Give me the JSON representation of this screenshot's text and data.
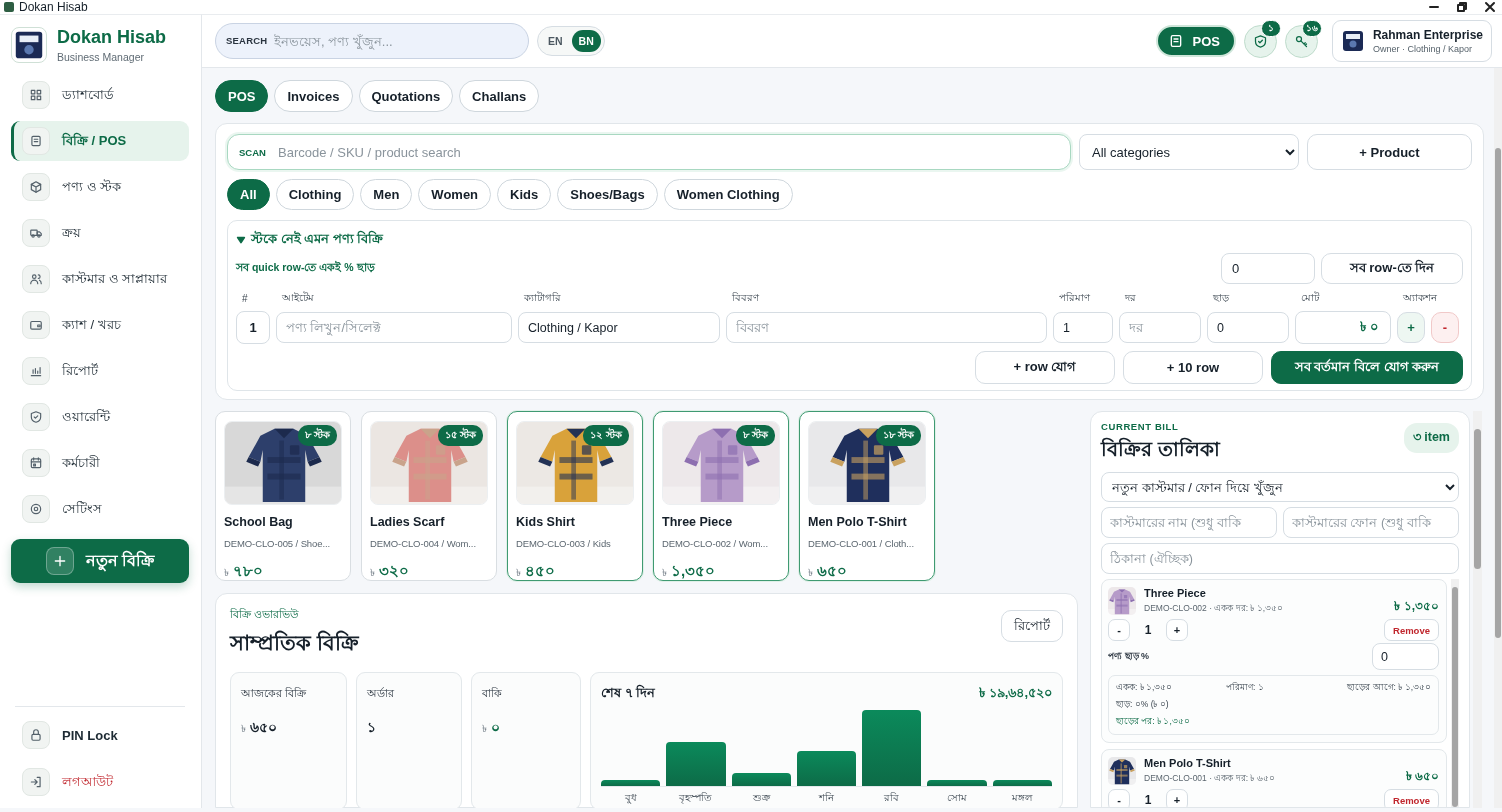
{
  "window": {
    "title": "Dokan Hisab"
  },
  "sidebar": {
    "brand": "Dokan Hisab",
    "subtitle": "Business Manager",
    "items": [
      {
        "label": "ড্যাশবোর্ড",
        "selected": false
      },
      {
        "label": "বিক্রি / POS",
        "selected": true
      },
      {
        "label": "পণ্য ও স্টক",
        "selected": false
      },
      {
        "label": "ক্রয়",
        "selected": false
      },
      {
        "label": "কাস্টমার ও সাপ্লায়ার",
        "selected": false
      },
      {
        "label": "ক্যাশ / খরচ",
        "selected": false
      },
      {
        "label": "রিপোর্ট",
        "selected": false
      },
      {
        "label": "ওয়ারেন্টি",
        "selected": false
      },
      {
        "label": "কর্মচারী",
        "selected": false
      },
      {
        "label": "সেটিংস",
        "selected": false
      }
    ],
    "new_sale_button": "নতুন বিক্রি",
    "footer": [
      {
        "label": "PIN Lock",
        "kind": "normal"
      },
      {
        "label": "লগআউট",
        "kind": "danger"
      }
    ]
  },
  "header": {
    "search_label": "SEARCH",
    "search_placeholder": "ইনভয়েস, পণ্য খুঁজুন...",
    "languages": [
      {
        "label": "EN",
        "selected": false
      },
      {
        "label": "BN",
        "selected": true
      }
    ],
    "pos_button": "POS",
    "alerts": [
      {
        "badge": "১"
      },
      {
        "badge": "১৬"
      }
    ],
    "profile": {
      "name": "Rahman Enterprise",
      "role": "Owner · Clothing / Kapor"
    }
  },
  "tabs": [
    {
      "label": "POS",
      "selected": true
    },
    {
      "label": "Invoices",
      "selected": false
    },
    {
      "label": "Quotations",
      "selected": false
    },
    {
      "label": "Challans",
      "selected": false
    }
  ],
  "pos": {
    "scan_label": "SCAN",
    "scan_placeholder": "Barcode / SKU / product search",
    "category_select": "All categories",
    "add_product_button": "+ Product",
    "chips": [
      {
        "label": "All",
        "selected": true
      },
      {
        "label": "Clothing",
        "selected": false
      },
      {
        "label": "Men",
        "selected": false
      },
      {
        "label": "Women",
        "selected": false
      },
      {
        "label": "Kids",
        "selected": false
      },
      {
        "label": "Shoes/Bags",
        "selected": false
      },
      {
        "label": "Women Clothing",
        "selected": false
      }
    ],
    "quick_sale": {
      "title": "স্টকে নেই এমন পণ্য বিক্রি",
      "expanded": true,
      "note": "সব quick row-তে একই % ছাড়",
      "discount_value": "0",
      "apply_button": "সব row-তে দিন",
      "columns": [
        "#",
        "আইটেম",
        "ক্যাটাগরি",
        "বিবরণ",
        "পরিমাণ",
        "দর",
        "ছাড়",
        "মোট",
        "অ্যাকশন"
      ],
      "rows": [
        {
          "index": "1",
          "item_placeholder": "পণ্য লিখুন/সিলেক্ট",
          "category": "Clothing / Kapor",
          "description_placeholder": "বিবরণ",
          "quantity": "1",
          "rate_placeholder": "দর",
          "discount": "0",
          "total": "৳ ০",
          "add": "+",
          "remove": "-"
        }
      ],
      "add_row_button": "+ row যোগ",
      "add_ten_button": "+ 10 row",
      "add_all_button": "সব বর্তমান বিলে যোগ করুন"
    }
  },
  "products": [
    {
      "name": "School Bag",
      "code": "DEMO-CLO-005 / Shoe...",
      "currency": "৳",
      "price": "৭৮০",
      "stock": "৮ স্টক",
      "in_cart": false
    },
    {
      "name": "Ladies Scarf",
      "code": "DEMO-CLO-004 / Wom...",
      "currency": "৳",
      "price": "৩২০",
      "stock": "১৫ স্টক",
      "in_cart": false
    },
    {
      "name": "Kids Shirt",
      "code": "DEMO-CLO-003 / Kids",
      "currency": "৳",
      "price": "৪৫০",
      "stock": "১২ স্টক",
      "in_cart": true
    },
    {
      "name": "Three Piece",
      "code": "DEMO-CLO-002 / Wom...",
      "currency": "৳",
      "price": "১,৩৫০",
      "stock": "৮ স্টক",
      "in_cart": true
    },
    {
      "name": "Men Polo T-Shirt",
      "code": "DEMO-CLO-001 / Cloth...",
      "currency": "৳",
      "price": "৬৫০",
      "stock": "১৮ স্টক",
      "in_cart": true
    }
  ],
  "overview": {
    "eyebrow": "বিক্রি ওভারভিউ",
    "title": "সাম্প্রতিক বিক্রি",
    "report_button": "রিপোর্ট",
    "stats": [
      {
        "label": "আজকের বিক্রি",
        "currency": "৳",
        "value": "৬৫০",
        "kind": "amount"
      },
      {
        "label": "অর্ডার",
        "value": "১",
        "kind": "count"
      },
      {
        "label": "বাকি",
        "currency": "৳",
        "value": "০",
        "kind": "due"
      }
    ],
    "chart": {
      "title": "শেষ ৭ দিন",
      "total": "৳ ১৯,৬৪,৫২০",
      "days": [
        "বুধ",
        "বৃহস্পতি",
        "শুক্র",
        "শনি",
        "রবি",
        "সোম",
        "মঙ্গল"
      ]
    }
  },
  "cart": {
    "eyebrow": "CURRENT BILL",
    "title": "বিক্রির তালিকা",
    "count": "৩ item",
    "customer_select": "নতুন কাস্টমার / ফোন দিয়ে খুঁজুন",
    "name_placeholder": "কাস্টমারের নাম (শুধু বাকি",
    "phone_placeholder": "কাস্টমারের ফোন (শুধু বাকি",
    "address_placeholder": "ঠিকানা (ঐচ্ছিক)",
    "items": [
      {
        "name": "Three Piece",
        "meta": "DEMO-CLO-002 · একক দর: ৳ ১,৩৫০",
        "total": "৳ ১,৩৫০",
        "minus": "-",
        "qty": "1",
        "plus": "+",
        "remove": "Remove",
        "discount_label": "পণ্য ছাড় %",
        "discount": "0",
        "breakdown": {
          "unit": "একক: ৳ ১,৩৫০",
          "qty": "পরিমাণ: ১",
          "before": "ছাড়ের আগে: ৳ ১,৩৫০",
          "discount": "ছাড়: ০% (৳ ০)",
          "after": "ছাড়ের পর: ৳ ১,৩৫০"
        }
      },
      {
        "name": "Men Polo T-Shirt",
        "meta": "DEMO-CLO-001 · একক দর: ৳ ৬৫০",
        "total": "৳ ৬৫০",
        "minus": "-",
        "qty": "1",
        "plus": "+",
        "remove": "Remove"
      }
    ]
  }
}
